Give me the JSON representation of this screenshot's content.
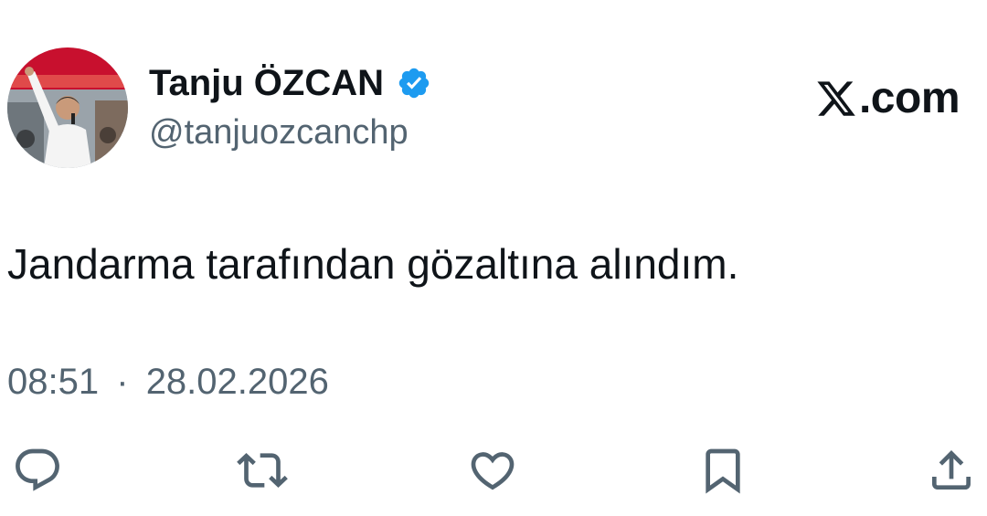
{
  "author": {
    "display_name": "Tanju ÖZCAN",
    "handle": "@tanjuozcanchp",
    "verified": true,
    "verified_color": "#1d9bf0"
  },
  "brand": {
    "domain_text": ".com",
    "logo_icon": "x-logo-icon"
  },
  "tweet": {
    "text": "Jandarma tarafından gözaltına alındım.",
    "time": "08:51",
    "separator": "·",
    "date": "28.02.2026"
  },
  "actions": [
    {
      "name": "reply",
      "icon": "reply-icon"
    },
    {
      "name": "retweet",
      "icon": "retweet-icon"
    },
    {
      "name": "like",
      "icon": "heart-icon"
    },
    {
      "name": "bookmark",
      "icon": "bookmark-icon"
    },
    {
      "name": "share",
      "icon": "share-icon"
    }
  ],
  "colors": {
    "text_primary": "#0f1419",
    "text_secondary": "#536471",
    "icon_gray": "#536471",
    "avatar_bg": "#c8102e"
  }
}
